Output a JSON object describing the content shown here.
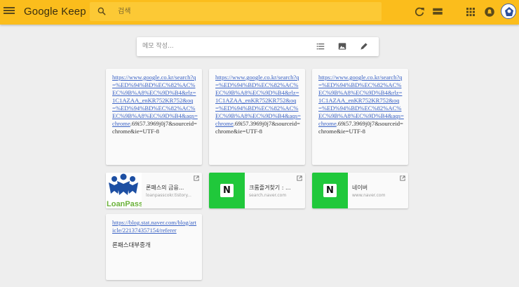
{
  "header": {
    "app_name": "Google Keep",
    "search_placeholder": "검색",
    "colors": {
      "bar": "#fbbd1c",
      "search_bg": "#fcc935"
    },
    "icons": [
      "menu-icon",
      "search-icon",
      "refresh-icon",
      "list-view-icon",
      "apps-grid-icon",
      "notifications-icon",
      "account-avatar"
    ]
  },
  "take_note": {
    "placeholder": "메모 작성...",
    "icons": [
      "checklist-icon",
      "image-icon",
      "drawing-icon"
    ]
  },
  "notes": [
    {
      "link_text": "https://www.google.co.kr/search?q=%ED%94%BD%EC%82%AC%EC%9B%A8%EC%9D%B4&rlz=1C1AZAA_enKR752KR752&oq=%ED%94%BD%EC%82%AC%EC%9B%A8%EC%9D%B4&aqs=chrome",
      "tail_text": ".69i57.3969j0j7&sourceid=chrome&ie=UTF-8"
    },
    {
      "link_text": "https://www.google.co.kr/search?q=%ED%94%BD%EC%82%AC%EC%9B%A8%EC%9D%B4&rlz=1C1AZAA_enKR752KR752&oq=%ED%94%BD%EC%82%AC%EC%9B%A8%EC%9D%B4&aqs=chrome",
      "tail_text": ".69i57.3969j0j7&sourceid=chrome&ie=UTF-8"
    },
    {
      "link_text": "https://www.google.co.kr/search?q=%ED%94%BD%EC%82%AC%EC%9B%A8%EC%9D%B4&rlz=1C1AZAA_enKR752KR752&oq=%ED%94%BD%EC%82%AC%EC%9B%A8%EC%9D%B4&aqs=chrome",
      "tail_text": ".69i57.3969j0j7&sourceid=chrome&ie=UTF-8"
    }
  ],
  "link_cards": [
    {
      "title": "론패스의 금융...",
      "url": "loanpasscokr.tistory...",
      "thumb": "LoanPass"
    },
    {
      "title": "크롬즐겨찾기 : ...",
      "url": "search.naver.com",
      "thumb": "N"
    },
    {
      "title": "네이버",
      "url": "www.naver.com",
      "thumb": "N"
    }
  ],
  "note4": {
    "link_text": "https://blog.stat.naver.com/blog/article/221374357154/referer",
    "body": "론패스대부중개"
  }
}
